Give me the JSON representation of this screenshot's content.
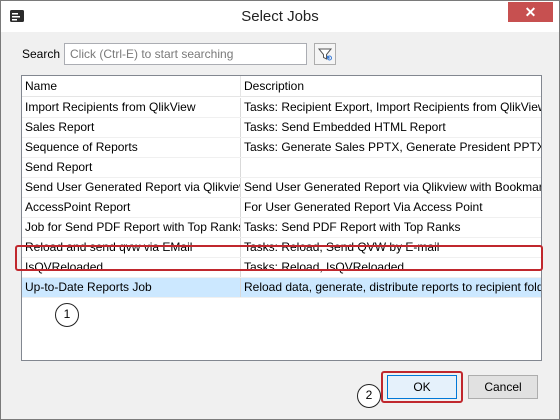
{
  "window": {
    "title": "Select Jobs",
    "close_glyph": "✕"
  },
  "search": {
    "label": "Search",
    "placeholder": "Click (Ctrl-E) to start searching"
  },
  "table": {
    "headers": [
      "Name",
      "Description"
    ],
    "rows": [
      {
        "name": "Import Recipients from QlikView",
        "description": "Tasks: Recipient Export, Import Recipients from QlikView"
      },
      {
        "name": "Sales Report",
        "description": "Tasks: Send Embedded HTML Report"
      },
      {
        "name": "Sequence of Reports",
        "description": "Tasks: Generate Sales PPTX, Generate President PPTX"
      },
      {
        "name": "Send Report",
        "description": ""
      },
      {
        "name": "Send User Generated Report via Qlikview",
        "description": "Send User Generated Report via Qlikview with Bookmark"
      },
      {
        "name": "AccessPoint Report",
        "description": "For User Generated Report Via Access Point"
      },
      {
        "name": "Job for Send PDF Report with Top Ranks",
        "description": "Tasks: Send PDF Report with Top Ranks"
      },
      {
        "name": "Reload and send qvw via EMail",
        "description": "Tasks: Reload, Send QVW by E-mail"
      },
      {
        "name": "IsQVReloaded",
        "description": "Tasks: Reload, IsQVReloaded"
      },
      {
        "name": "Up-to-Date Reports Job",
        "description": "Reload data, generate, distribute reports to recipient folders"
      }
    ],
    "selected_index": 9
  },
  "callouts": {
    "one": "1",
    "two": "2"
  },
  "buttons": {
    "ok": "OK",
    "cancel": "Cancel"
  },
  "icons": {
    "app": "app-icon",
    "filter": "filter-icon",
    "close": "close-icon"
  },
  "colors": {
    "selection": "#cce8ff",
    "highlight": "#c0272d",
    "close": "#c75050"
  }
}
